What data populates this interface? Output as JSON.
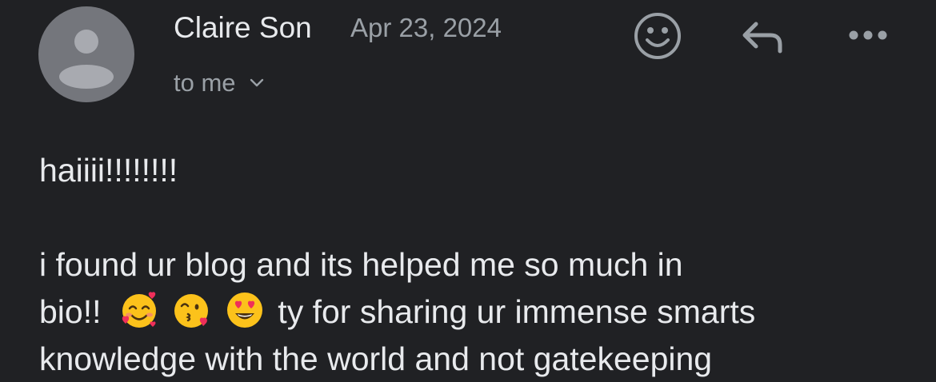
{
  "email": {
    "sender_name": "Claire Son",
    "date": "Apr 23, 2024",
    "recipient": "to me",
    "body": {
      "greeting": "haiiii!!!!!!!!",
      "line1": "i found ur blog and its helped me so much in",
      "line2_start": "bio!!",
      "line2_end": "ty for sharing ur immense smarts",
      "line3": "knowledge with the world and not gatekeeping"
    }
  },
  "icons": {
    "avatar": "person-avatar",
    "reaction": "smiley-icon",
    "reply": "reply-arrow-icon",
    "more": "more-dots-icon",
    "recipient_toggle": "chevron-down-icon",
    "emojis": [
      "smiling-face-with-hearts",
      "face-blowing-a-kiss",
      "smiling-face-with-heart-eyes"
    ]
  },
  "colors": {
    "background": "#202124",
    "primary_text": "#e8eaed",
    "secondary_text": "#9aa0a6",
    "avatar": "#74767c",
    "emoji_yellow": "#fcc21b",
    "heart_red": "#ef2f5a"
  }
}
